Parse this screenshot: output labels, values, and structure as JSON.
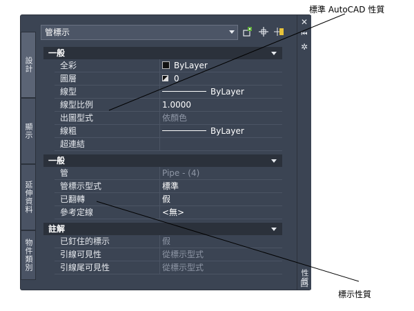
{
  "callouts": {
    "standard": "標準 AutoCAD 性質",
    "display": "標示性質"
  },
  "window": {
    "title": "性質",
    "strip_buttons": [
      "✕",
      "⏮",
      "✲"
    ],
    "strip_bottom_icon": "回"
  },
  "tabs": [
    "設計",
    "顯示",
    "延伸資料",
    "物件類別"
  ],
  "selector": {
    "value": "管標示"
  },
  "tool_icons": [
    "select-objects-icon",
    "pickadd-icon",
    "quick-select-icon"
  ],
  "sections": [
    {
      "title": "一般",
      "rows": [
        {
          "key": "全彩",
          "value": "ByLayer",
          "type": "color"
        },
        {
          "key": "圖層",
          "value": "0",
          "type": "layer"
        },
        {
          "key": "線型",
          "value": "ByLayer",
          "type": "line"
        },
        {
          "key": "線型比例",
          "value": "1.0000",
          "type": "text"
        },
        {
          "key": "出圖型式",
          "value": "依顏色",
          "type": "dim"
        },
        {
          "key": "線粗",
          "value": "ByLayer",
          "type": "line"
        },
        {
          "key": "超連結",
          "value": "",
          "type": "text"
        }
      ]
    },
    {
      "title": "一般",
      "rows": [
        {
          "key": "管",
          "value": "Pipe - (4)",
          "type": "dim"
        },
        {
          "key": "管標示型式",
          "value": "標準",
          "type": "text"
        },
        {
          "key": "已翻轉",
          "value": "假",
          "type": "text"
        },
        {
          "key": "參考定線",
          "value": "<無>",
          "type": "text"
        }
      ]
    },
    {
      "title": "註解",
      "rows": [
        {
          "key": "已釘住的標示",
          "value": "假",
          "type": "dim"
        },
        {
          "key": "引線可見性",
          "value": "從標示型式",
          "type": "dim"
        },
        {
          "key": "引線尾可見性",
          "value": "從標示型式",
          "type": "dim"
        }
      ]
    }
  ]
}
